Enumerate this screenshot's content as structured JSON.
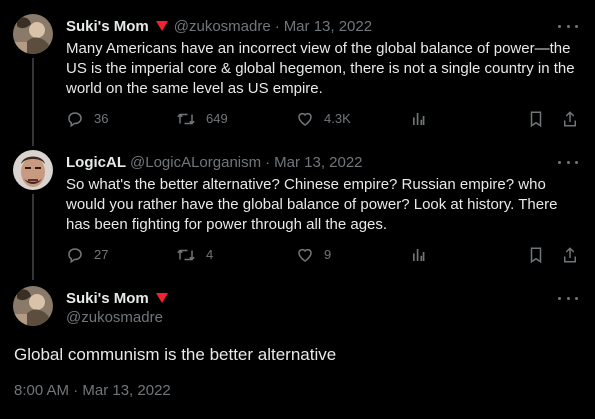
{
  "tweets": [
    {
      "name": "Suki's Mom",
      "handle": "@zukosmadre",
      "date": "Mar 13, 2022",
      "text": "Many Americans have an incorrect view of the global balance of power—the US is the imperial core & global hegemon, there is not a single country in the world on the same level as US empire.",
      "replies": "36",
      "retweets": "649",
      "likes": "4.3K"
    },
    {
      "name": "LogicAL",
      "handle": "@LogicALorganism",
      "date": "Mar 13, 2022",
      "text": "So what's the better alternative? Chinese empire? Russian empire? who would you rather have the global balance of power? Look at history. There has been fighting for power through all the ages.",
      "replies": "27",
      "retweets": "4",
      "likes": "9"
    }
  ],
  "main": {
    "name": "Suki's Mom",
    "handle": "@zukosmadre",
    "text": "Global communism is the better alternative",
    "timestamp": "8:00 AM · Mar 13, 2022"
  },
  "separator": "·",
  "colors": {
    "background": "#000000",
    "text": "#e7e9ea",
    "muted": "#71767b",
    "badge": "#f4212e",
    "thread": "#333639"
  },
  "icons": [
    "reply-icon",
    "retweet-icon",
    "like-icon",
    "views-icon",
    "bookmark-icon",
    "share-icon",
    "more-icon",
    "verified-badge-icon"
  ]
}
